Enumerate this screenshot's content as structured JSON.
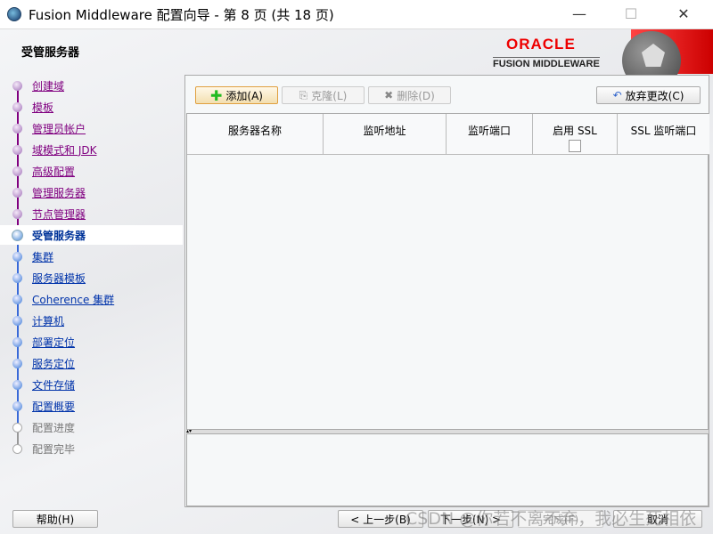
{
  "window": {
    "title": "Fusion Middleware 配置向导 - 第 8 页 (共 18 页)",
    "minimize": "—",
    "maximize": "☐",
    "close": "✕"
  },
  "header": {
    "page_heading": "受管服务器",
    "logo_oracle": "ORACLE",
    "logo_fmw": "FUSION MIDDLEWARE"
  },
  "sidebar": {
    "items": [
      {
        "label": "创建域",
        "state": "visited"
      },
      {
        "label": "模板",
        "state": "visited"
      },
      {
        "label": "管理员帐户",
        "state": "visited"
      },
      {
        "label": "域模式和 JDK",
        "state": "visited"
      },
      {
        "label": "高级配置",
        "state": "visited"
      },
      {
        "label": "管理服务器",
        "state": "visited"
      },
      {
        "label": "节点管理器",
        "state": "visited"
      },
      {
        "label": "受管服务器",
        "state": "current"
      },
      {
        "label": "集群",
        "state": "todo"
      },
      {
        "label": "服务器模板",
        "state": "todo"
      },
      {
        "label": "Coherence 集群",
        "state": "todo"
      },
      {
        "label": "计算机",
        "state": "todo"
      },
      {
        "label": "部署定位",
        "state": "todo"
      },
      {
        "label": "服务定位",
        "state": "todo"
      },
      {
        "label": "文件存储",
        "state": "todo"
      },
      {
        "label": "配置概要",
        "state": "todo"
      },
      {
        "label": "配置进度",
        "state": "disabled"
      },
      {
        "label": "配置完毕",
        "state": "disabled"
      }
    ]
  },
  "toolbar": {
    "add": "添加(A)",
    "clone": "克隆(L)",
    "delete": "删除(D)",
    "discard": "放弃更改(C)"
  },
  "table": {
    "columns": [
      "服务器名称",
      "监听地址",
      "监听端口",
      "启用 SSL",
      "SSL 监听端口"
    ],
    "ssl_checked": false,
    "rows": []
  },
  "footer": {
    "help": "帮助(H)",
    "back": "< 上一步(B)",
    "next": "下一步(N) >",
    "finish": "完成(F)",
    "cancel": "取消"
  },
  "watermark": "CSDN @你若不离不弃，我必生死相依"
}
